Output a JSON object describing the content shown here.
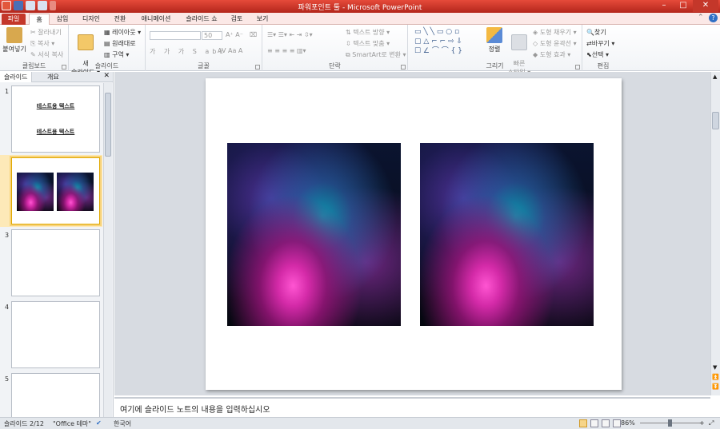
{
  "window": {
    "title": "파워포인트 툴 - Microsoft PowerPoint",
    "minimize": "–",
    "maximize": "□",
    "close": "✕"
  },
  "ribbon_tabs": [
    "파일",
    "홈",
    "삽입",
    "디자인",
    "전환",
    "애니메이션",
    "슬라이드 쇼",
    "검토",
    "보기"
  ],
  "active_tab": "홈",
  "clipboard": {
    "paste": "붙여넣기",
    "cut": "잘라내기",
    "copy": "복사 ▾",
    "format_painter": "서식 복사",
    "label": "클립보드"
  },
  "slides_group": {
    "new_slide": "새\n슬라이드 ▾",
    "layout": "레이아웃 ▾",
    "reset": "원래대로",
    "section": "구역 ▾",
    "label": "슬라이드"
  },
  "font_group": {
    "font_name": "",
    "font_size": "50",
    "label": "글꼴"
  },
  "paragraph": {
    "text_direction": "텍스트 방향 ▾",
    "align_text": "텍스트 맞춤 ▾",
    "smartart": "SmartArt로 변환 ▾",
    "label": "단락"
  },
  "drawing": {
    "arrange": "정렬",
    "quick_styles": "빠른\n스타일 ▾",
    "shape_fill": "도형 채우기 ▾",
    "shape_outline": "도형 윤곽선 ▾",
    "shape_effects": "도형 효과 ▾",
    "label": "그리기"
  },
  "editing": {
    "find": "찾기",
    "replace": "바꾸기 ▾",
    "select": "선택 ▾",
    "label": "편집"
  },
  "left_pane": {
    "tab_slides": "슬라이드",
    "tab_outline": "개요",
    "close": "✕"
  },
  "thumbnails": [
    {
      "num": "1",
      "lines": [
        "테스트용 텍스트",
        "테스트용 텍스트"
      ]
    },
    {
      "num": "2"
    },
    {
      "num": "3"
    },
    {
      "num": "4"
    },
    {
      "num": "5"
    }
  ],
  "notes": {
    "placeholder": "여기에 슬라이드 노트의 내용을 입력하십시오"
  },
  "status": {
    "slide_info": "슬라이드 2/12",
    "theme": "\"Office 테마\"",
    "language": "한국어",
    "zoom": "86%",
    "zoom_minus": "−",
    "zoom_plus": "+"
  },
  "colors": {
    "title_bar": "#c4372a",
    "ribbon_tab_bg": "#fbe8e6",
    "canvas_bg": "#d7dbe1"
  }
}
